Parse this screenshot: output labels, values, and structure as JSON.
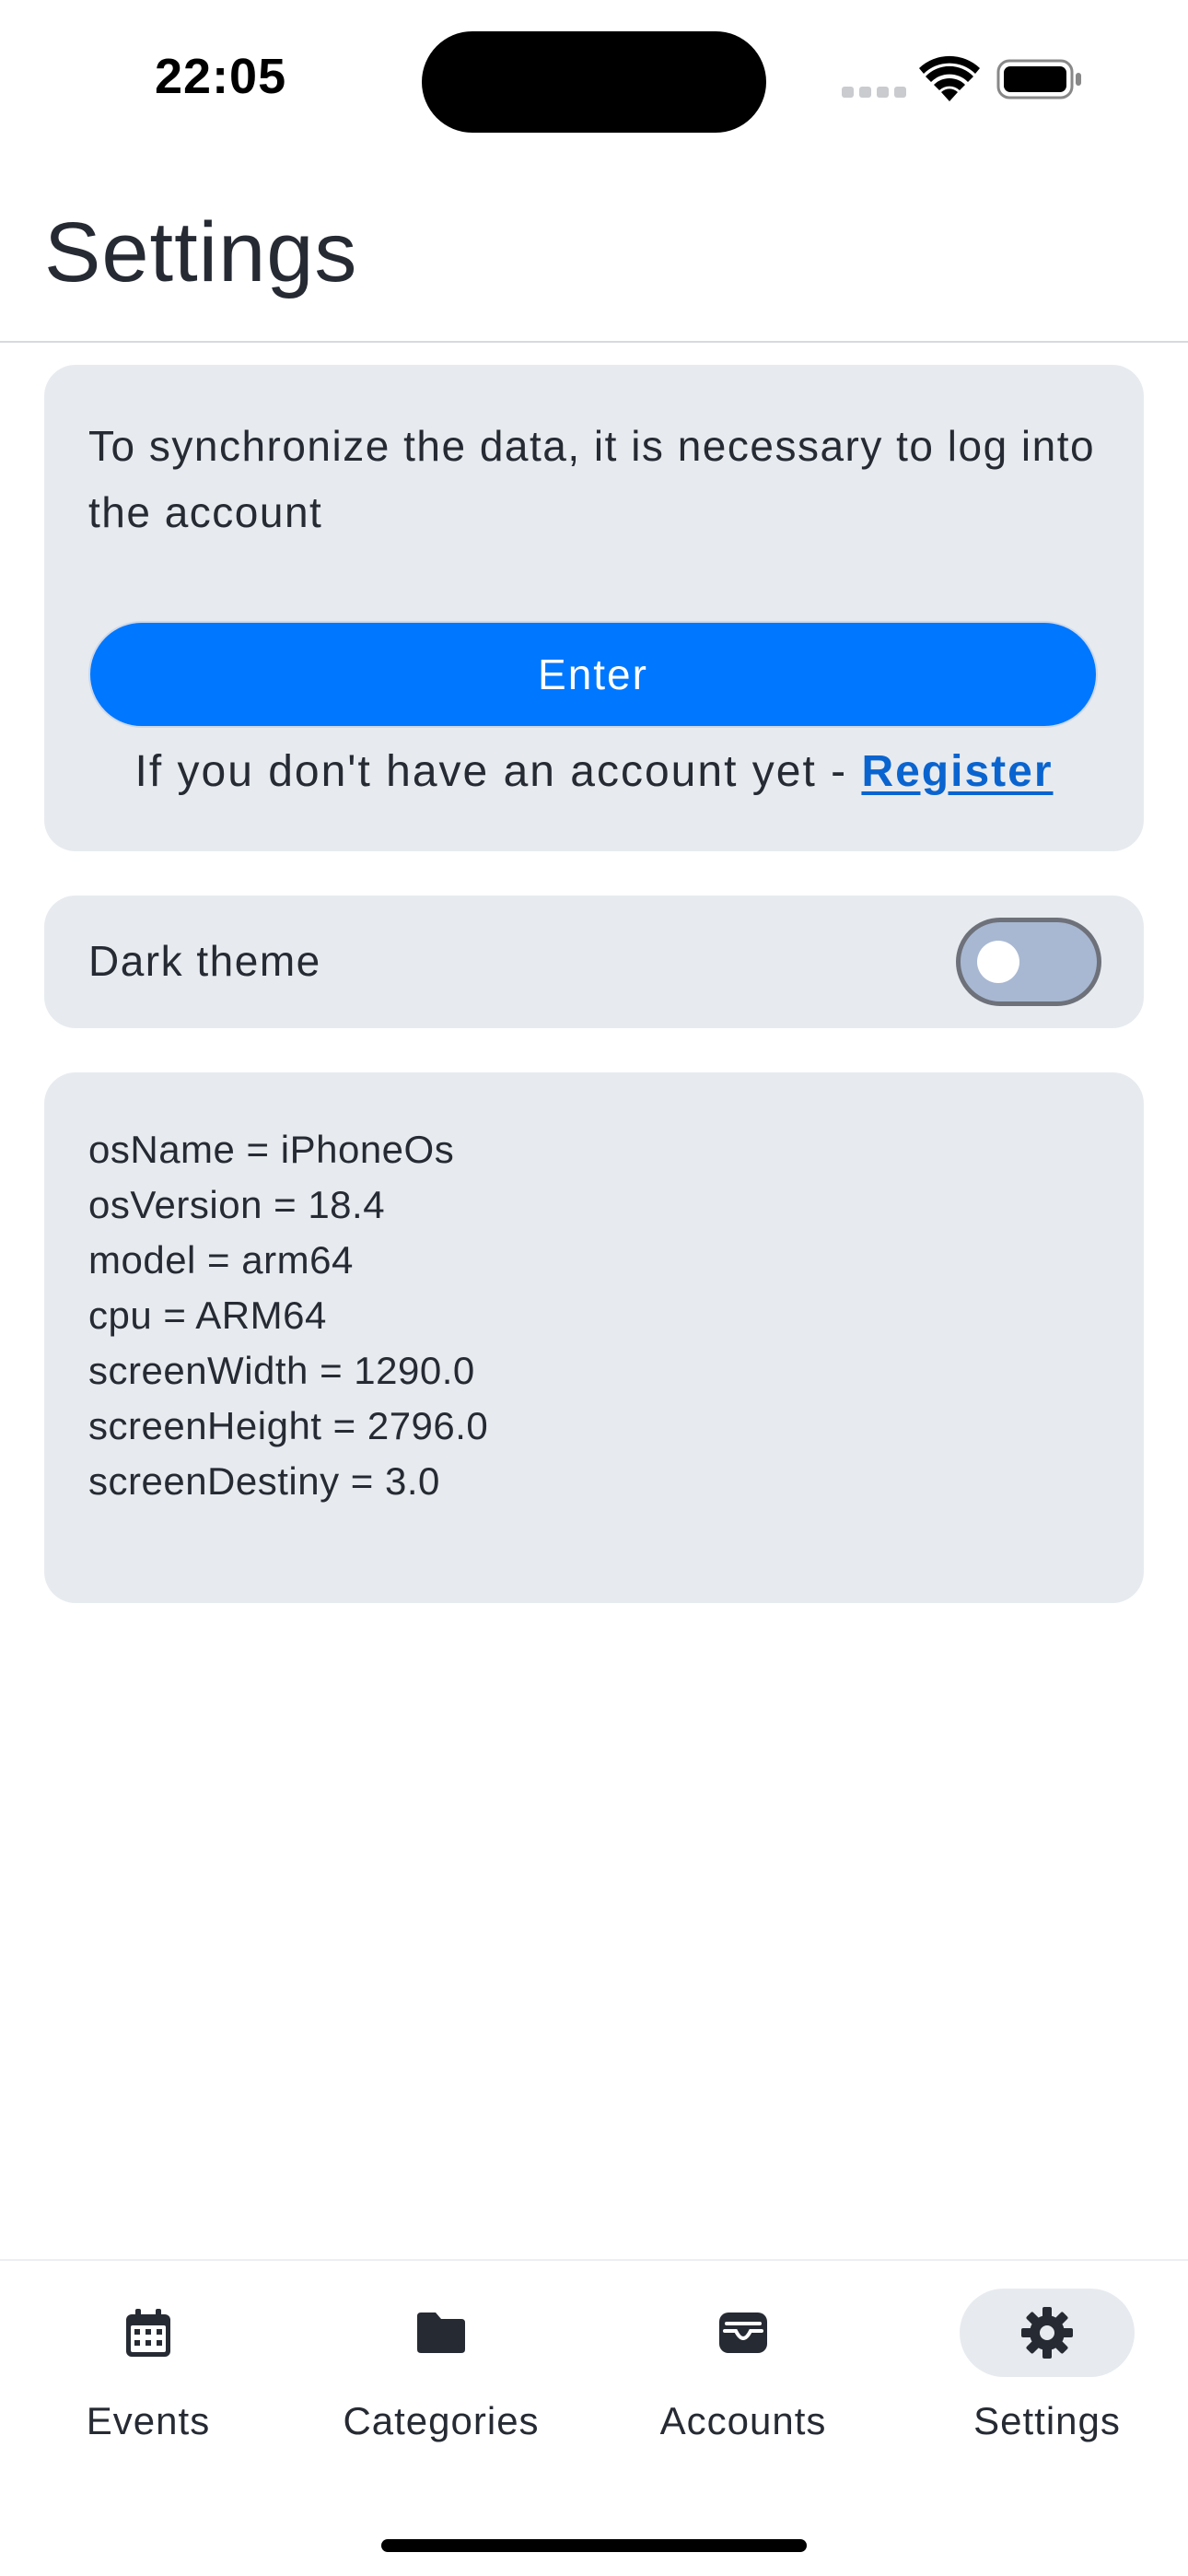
{
  "status_bar": {
    "time": "22:05",
    "icons": [
      "cellular-icon",
      "wifi-icon",
      "battery-icon"
    ]
  },
  "header": {
    "title": "Settings"
  },
  "login_card": {
    "message": "To synchronize the data, it is necessary to log into the account",
    "enter_label": "Enter",
    "register_prompt": "If you don't have an account yet - ",
    "register_link": "Register"
  },
  "theme_card": {
    "label": "Dark theme",
    "enabled": false
  },
  "device_info": {
    "lines": [
      "osName = iPhoneOs",
      "osVersion = 18.4",
      "model = arm64",
      "cpu = ARM64",
      "screenWidth = 1290.0",
      "screenHeight = 2796.0",
      "screenDestiny = 3.0"
    ]
  },
  "bottom_nav": {
    "items": [
      {
        "label": "Events",
        "icon": "calendar-icon",
        "active": false
      },
      {
        "label": "Categories",
        "icon": "folder-icon",
        "active": false
      },
      {
        "label": "Accounts",
        "icon": "wallet-icon",
        "active": false
      },
      {
        "label": "Settings",
        "icon": "gear-icon",
        "active": true
      }
    ]
  },
  "colors": {
    "accent": "#0077ff",
    "link": "#0a64cf",
    "card_background": "#e7ebef",
    "text": "#262a33"
  }
}
